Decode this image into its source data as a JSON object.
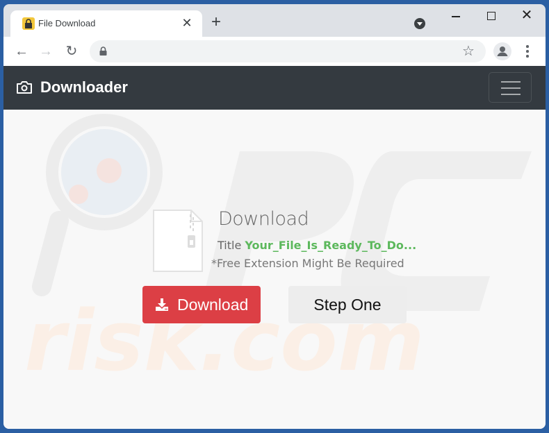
{
  "browser": {
    "tab": {
      "title": "File Download",
      "close_glyph": "✕"
    },
    "new_tab_glyph": "+",
    "window_controls": {
      "close_glyph": "✕"
    },
    "toolbar": {
      "back_glyph": "←",
      "forward_glyph": "→",
      "reload_glyph": "↻",
      "address": "",
      "star_glyph": "☆"
    }
  },
  "navbar": {
    "brand": "Downloader"
  },
  "content": {
    "heading": "Download",
    "title_label": "Title",
    "title_value": "Your_File_Is_Ready_To_Do...",
    "note": "*Free Extension Might Be Required",
    "download_button": "Download",
    "step_button": "Step One"
  },
  "colors": {
    "navbar": "#343a40",
    "download_button": "#dc3f45",
    "title_value": "#5cb85c",
    "step_button": "#ededed"
  }
}
